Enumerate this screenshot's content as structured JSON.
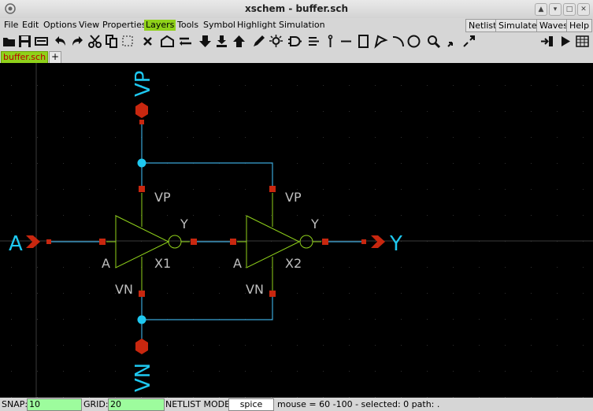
{
  "window": {
    "title": "xschem - buffer.sch",
    "buttons": [
      "▲",
      "▾",
      "□",
      "✕"
    ]
  },
  "menu": {
    "items": [
      "File",
      "Edit",
      "Options",
      "View",
      "Properties",
      "Layers",
      "Tools",
      "Symbol",
      "Highlight",
      "Simulation"
    ],
    "active": "Layers",
    "right_buttons": [
      "Netlist",
      "Simulate",
      "Waves",
      "Help"
    ]
  },
  "toolbar": {
    "icons": [
      "open-icon",
      "save-icon",
      "reload-icon",
      "undo-icon",
      "redo-icon",
      "cut-icon",
      "copy-icon",
      "delete-icon",
      "insert-symbol-icon",
      "wire-icon",
      "move-down-icon",
      "push-icon",
      "move-up-icon",
      "pen-icon",
      "bulb-icon",
      "gate-icon",
      "netlabel-icon",
      "pin-icon",
      "line-icon",
      "rect-icon",
      "polygon-icon",
      "arc-icon",
      "circle-icon",
      "zoom-icon",
      "zoom-out-icon",
      "zoom-in-icon",
      "goto-netlist-icon",
      "play-icon",
      "grid-icon"
    ]
  },
  "tabs": {
    "items": [
      "buffer.sch"
    ],
    "add_label": "+"
  },
  "schematic": {
    "pins": {
      "in": "A",
      "out": "Y",
      "vp": "VP",
      "vn": "VN"
    },
    "instances": [
      {
        "name": "X1",
        "in": "A",
        "out": "Y",
        "vp": "VP",
        "vn": "VN"
      },
      {
        "name": "X2",
        "in": "A",
        "out": "Y",
        "vp": "VP",
        "vn": "VN"
      }
    ],
    "colors": {
      "background": "#000000",
      "wire": "#3aa5d6",
      "pin": "#c8270f",
      "symbol": "#8fd11a",
      "label": "#bfbfbf",
      "pin_label": "#1ec8f0",
      "grid": "#303030"
    }
  },
  "status": {
    "snap_label": "SNAP:",
    "snap_value": "10",
    "grid_label": "GRID:",
    "grid_value": "20",
    "mode_label": "NETLIST MODE:",
    "mode_value": "spice",
    "mouse_text": "mouse = 60 -100 - selected: 0 path: ."
  }
}
